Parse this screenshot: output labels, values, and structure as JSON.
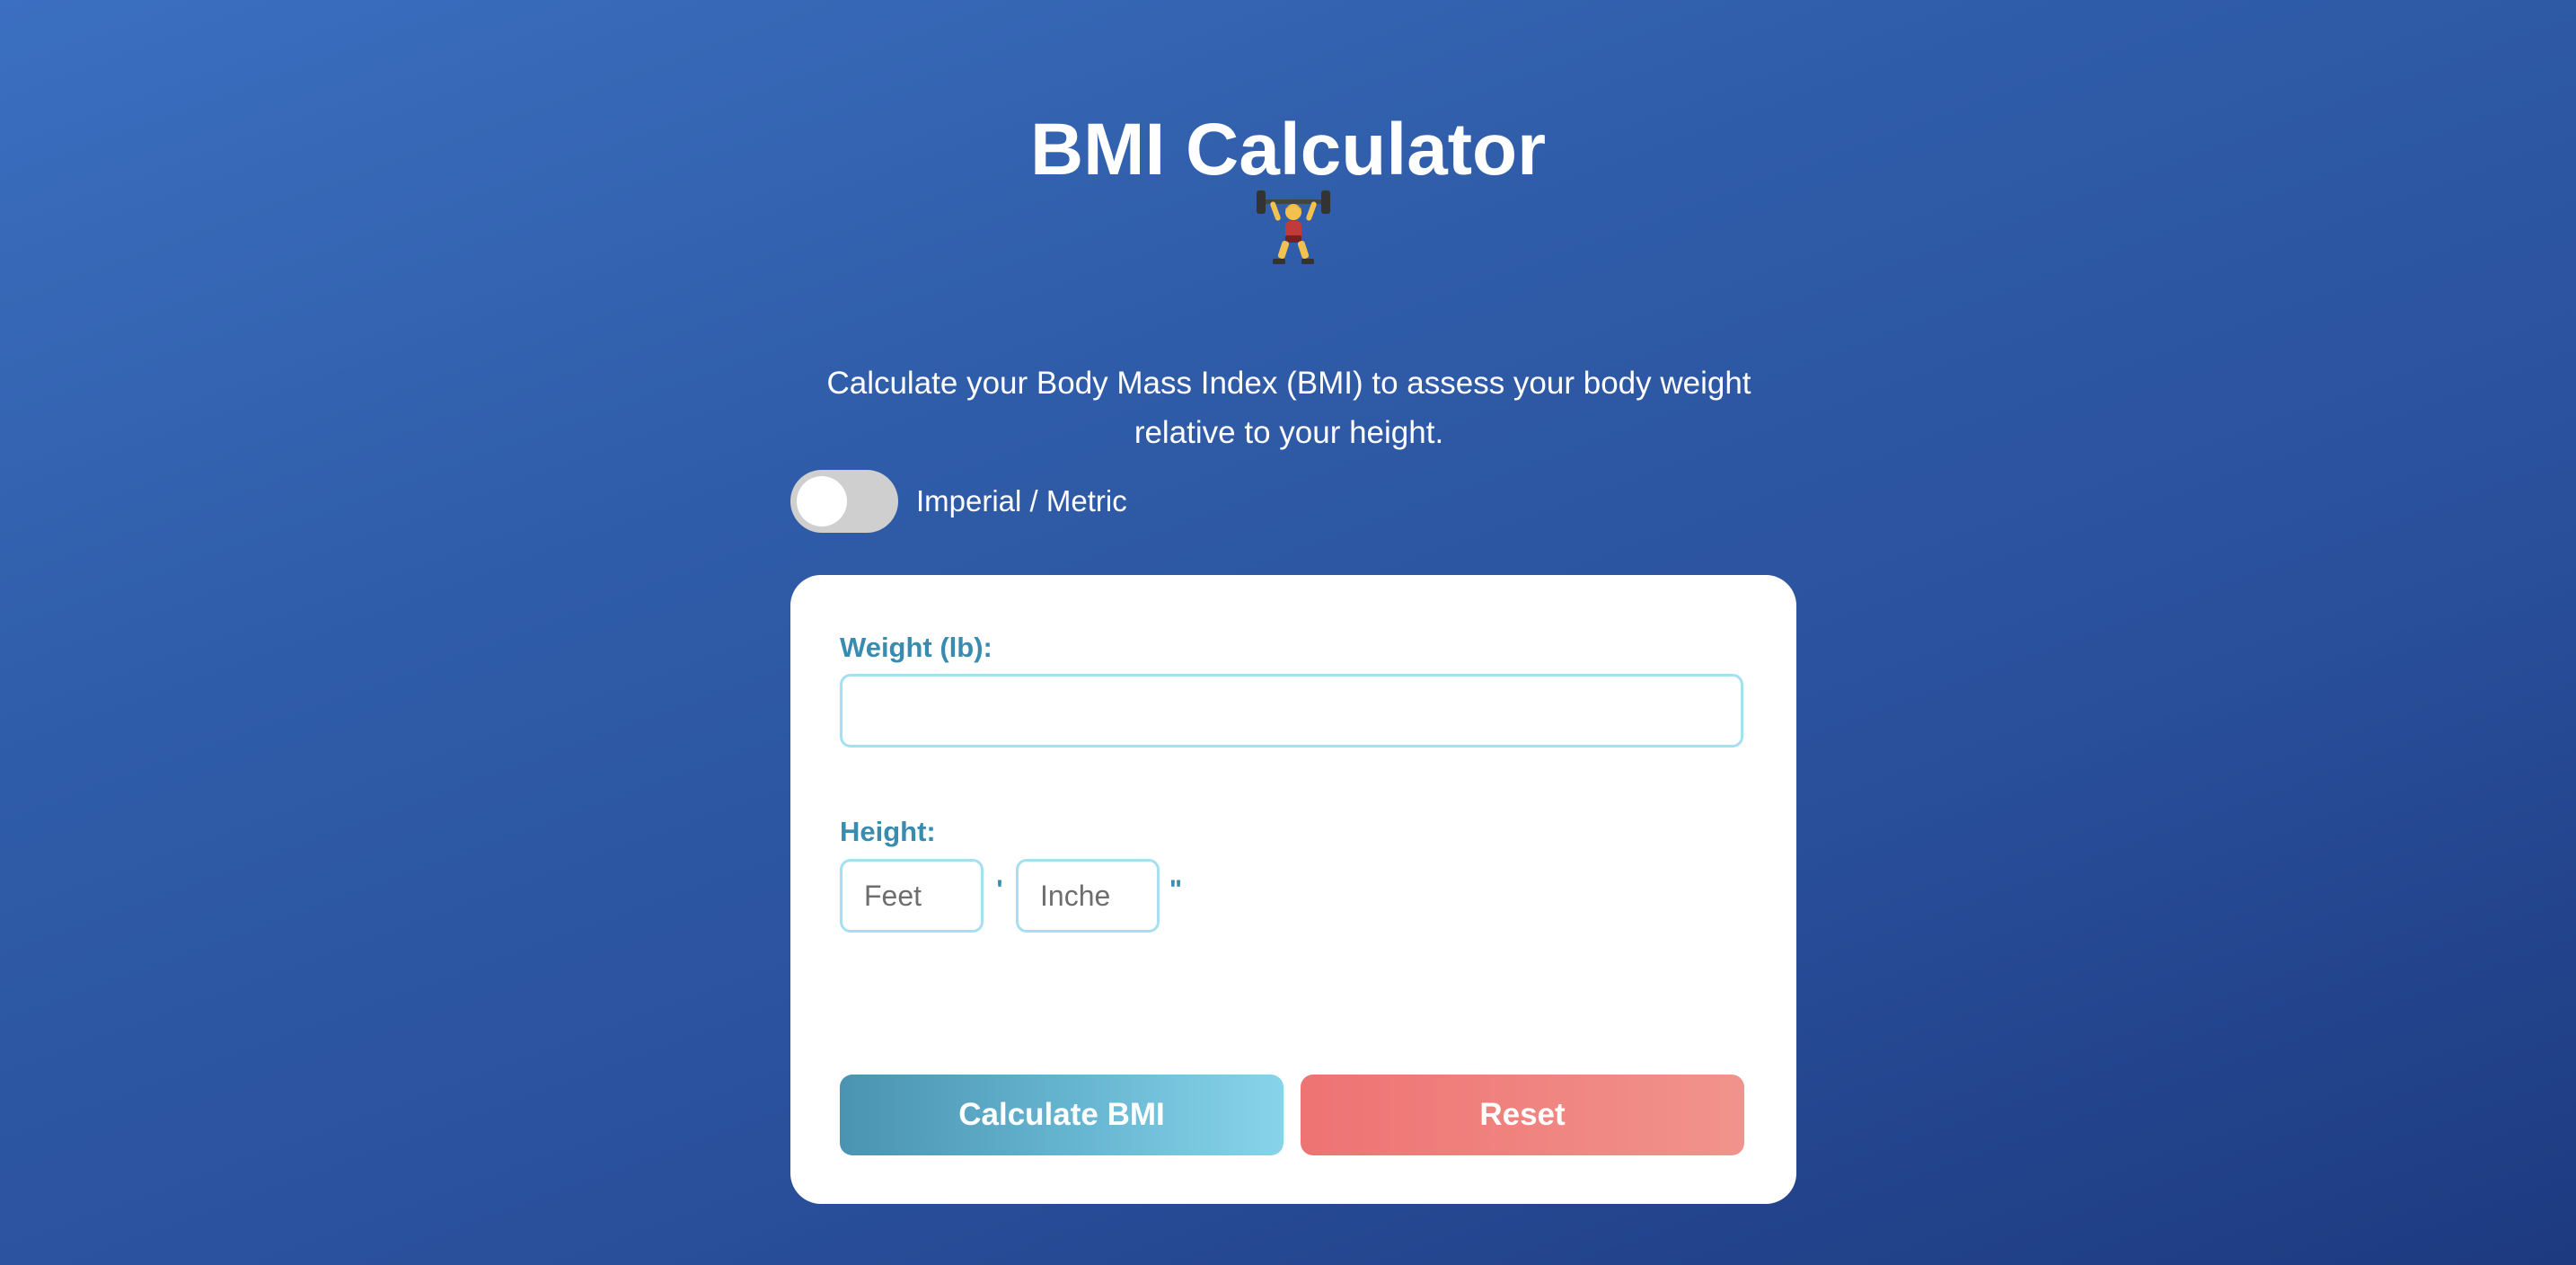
{
  "header": {
    "title": "BMI Calculator",
    "hero_icon": "weightlifter-icon",
    "description": "Calculate your Body Mass Index (BMI) to assess your body weight relative to your height."
  },
  "unit_toggle": {
    "label": "Imperial / Metric",
    "state": "off"
  },
  "form": {
    "weight_label": "Weight (lb):",
    "weight_value": "",
    "height_label": "Height:",
    "feet_placeholder": "Feet",
    "feet_value": "",
    "feet_mark": "'",
    "inches_placeholder": "Inche",
    "inches_value": "",
    "inches_mark": "\""
  },
  "buttons": {
    "calculate": "Calculate BMI",
    "reset": "Reset"
  },
  "colors": {
    "background": "#2f5ca8",
    "label": "#3a8bb0",
    "input_border": "#a6dff0",
    "calculate": "#4a93b1",
    "reset": "#ee7373",
    "toggle_off": "#cfcfcf"
  }
}
